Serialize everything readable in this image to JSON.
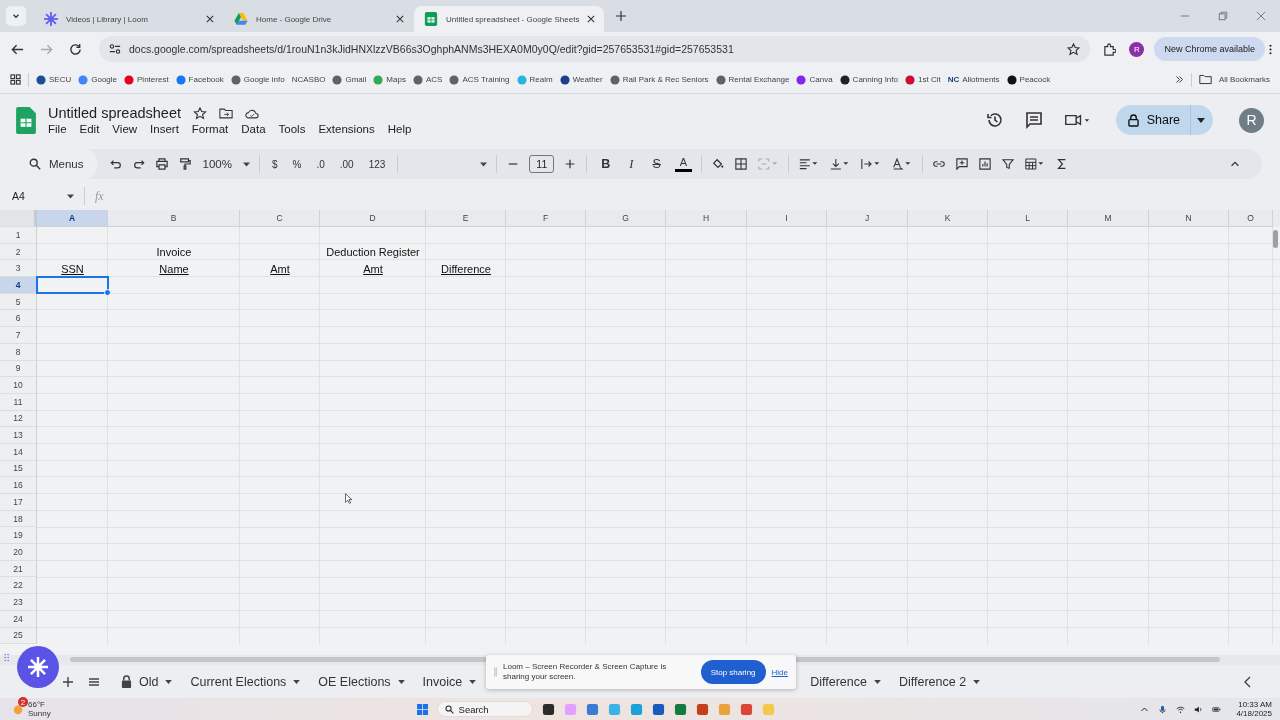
{
  "browser": {
    "tabs": [
      {
        "title": "Videos | Library | Loom",
        "kind": "loom",
        "selected": false
      },
      {
        "title": "Home - Google Drive",
        "kind": "drive",
        "selected": false
      },
      {
        "title": "Untitled spreadsheet - Google Sheets",
        "kind": "sheets",
        "selected": true
      }
    ],
    "url": "docs.google.com/spreadsheets/d/1rouN1n3kJidHNXlzzVB66s3OghphANMs3HEXA0M0y0Q/edit?gid=257653531#gid=257653531",
    "profile": "R",
    "update_button": "New Chrome available",
    "bookmarks": [
      {
        "label": "SECU",
        "color": "#1f4f8f"
      },
      {
        "label": "Google",
        "color": "#4285f4"
      },
      {
        "label": "Pinterest",
        "color": "#e60023"
      },
      {
        "label": "Facebook",
        "color": "#1877f2"
      },
      {
        "label": "Google info",
        "color": "#5f6368"
      },
      {
        "label": "NCASBO"
      },
      {
        "label": "Gmail",
        "color": "#5f6368"
      },
      {
        "label": "Maps",
        "color": "#34a853"
      },
      {
        "label": "ACS",
        "color": "#5f6368"
      },
      {
        "label": "ACS Training",
        "color": "#5f6368"
      },
      {
        "label": "Realm",
        "color": "#2bb3d9"
      },
      {
        "label": "Weather",
        "color": "#1c3f8f"
      },
      {
        "label": "Rail Park & Rec Seniors",
        "color": "#5f6368"
      },
      {
        "label": "Rental Exchange",
        "color": "#5f6368"
      },
      {
        "label": "Canva",
        "color": "#7d2ae8"
      },
      {
        "label": "Canning Info",
        "color": "#222222"
      },
      {
        "label": "1st Cit",
        "color": "#c8102e"
      },
      {
        "label": "Allotments",
        "badge": "NC"
      },
      {
        "label": "Peacock",
        "color": "#111111"
      }
    ],
    "all_bookmarks": "All Bookmarks"
  },
  "sheet": {
    "title": "Untitled spreadsheet",
    "menus": [
      "File",
      "Edit",
      "View",
      "Insert",
      "Format",
      "Data",
      "Tools",
      "Extensions",
      "Help"
    ],
    "share": "Share",
    "avatar": "R",
    "toolbar": {
      "search": "Menus",
      "zoom": "100%",
      "number_formats": [
        "$",
        "%",
        ".0",
        ".00",
        "123"
      ],
      "font_size": "11",
      "text_styles": [
        {
          "label": "B",
          "kind": "bold"
        },
        {
          "label": "I",
          "kind": "italic"
        },
        {
          "label": "S",
          "kind": "strike"
        },
        {
          "label": "A",
          "kind": "color"
        }
      ]
    },
    "name_box": "A4",
    "fx": "fx",
    "columns": [
      {
        "label": "A",
        "selected": true
      },
      {
        "label": "B",
        "selected": false
      },
      {
        "label": "C",
        "selected": false
      },
      {
        "label": "D",
        "selected": false
      },
      {
        "label": "E",
        "selected": false
      },
      {
        "label": "F",
        "selected": false
      },
      {
        "label": "G",
        "selected": false
      },
      {
        "label": "H",
        "selected": false
      },
      {
        "label": "I",
        "selected": false
      },
      {
        "label": "J",
        "selected": false
      },
      {
        "label": "K",
        "selected": false
      },
      {
        "label": "L",
        "selected": false
      },
      {
        "label": "M",
        "selected": false
      },
      {
        "label": "N",
        "selected": false
      },
      {
        "label": "O",
        "selected": false
      }
    ],
    "rows": [
      {
        "number": "1",
        "selected": false,
        "cells": []
      },
      {
        "number": "2",
        "selected": false,
        "underline": false,
        "cells": [
          "",
          "Invoice",
          "",
          "Deduction Register"
        ]
      },
      {
        "number": "3",
        "selected": false,
        "underline": true,
        "cells": [
          "SSN",
          "Name",
          "Amt",
          "Amt",
          "Difference"
        ]
      },
      {
        "number": "4",
        "selected": true,
        "cells": []
      },
      {
        "number": "5",
        "selected": false,
        "cells": []
      },
      {
        "number": "6",
        "selected": false,
        "cells": []
      },
      {
        "number": "7",
        "selected": false,
        "cells": []
      },
      {
        "number": "8",
        "selected": false,
        "cells": []
      },
      {
        "number": "9",
        "selected": false,
        "cells": []
      },
      {
        "number": "10",
        "selected": false,
        "cells": []
      },
      {
        "number": "11",
        "selected": false,
        "cells": []
      },
      {
        "number": "12",
        "selected": false,
        "cells": []
      },
      {
        "number": "13",
        "selected": false,
        "cells": []
      },
      {
        "number": "14",
        "selected": false,
        "cells": []
      },
      {
        "number": "15",
        "selected": false,
        "cells": []
      },
      {
        "number": "16",
        "selected": false,
        "cells": []
      },
      {
        "number": "17",
        "selected": false,
        "cells": []
      },
      {
        "number": "18",
        "selected": false,
        "cells": []
      },
      {
        "number": "19",
        "selected": false,
        "cells": []
      },
      {
        "number": "20",
        "selected": false,
        "cells": []
      },
      {
        "number": "21",
        "selected": false,
        "cells": []
      },
      {
        "number": "22",
        "selected": false,
        "cells": []
      },
      {
        "number": "23",
        "selected": false,
        "cells": []
      },
      {
        "number": "24",
        "selected": false,
        "cells": []
      },
      {
        "number": "25",
        "selected": false,
        "cells": []
      }
    ],
    "sheet_tabs": [
      {
        "label": "Old",
        "locked": true,
        "selected": false
      },
      {
        "label": "Current Elections",
        "locked": false,
        "selected": false
      },
      {
        "label": "OE Elections",
        "locked": false,
        "selected": false
      },
      {
        "label": "Invoice",
        "locked": false,
        "selected": false
      },
      {
        "label": "Difference",
        "locked": false,
        "selected": false
      },
      {
        "label": "Difference 2",
        "locked": false,
        "selected": false
      }
    ]
  },
  "loom_notice": {
    "text": "Loom – Screen Recorder & Screen Capture is sharing your screen.",
    "stop": "Stop sharing",
    "hide": "Hide"
  },
  "taskbar": {
    "weather_badge": "2",
    "temperature": "66°F",
    "condition": "Sunny",
    "search": "Search",
    "time": "10:33 AM",
    "date": "4/18/2025"
  }
}
